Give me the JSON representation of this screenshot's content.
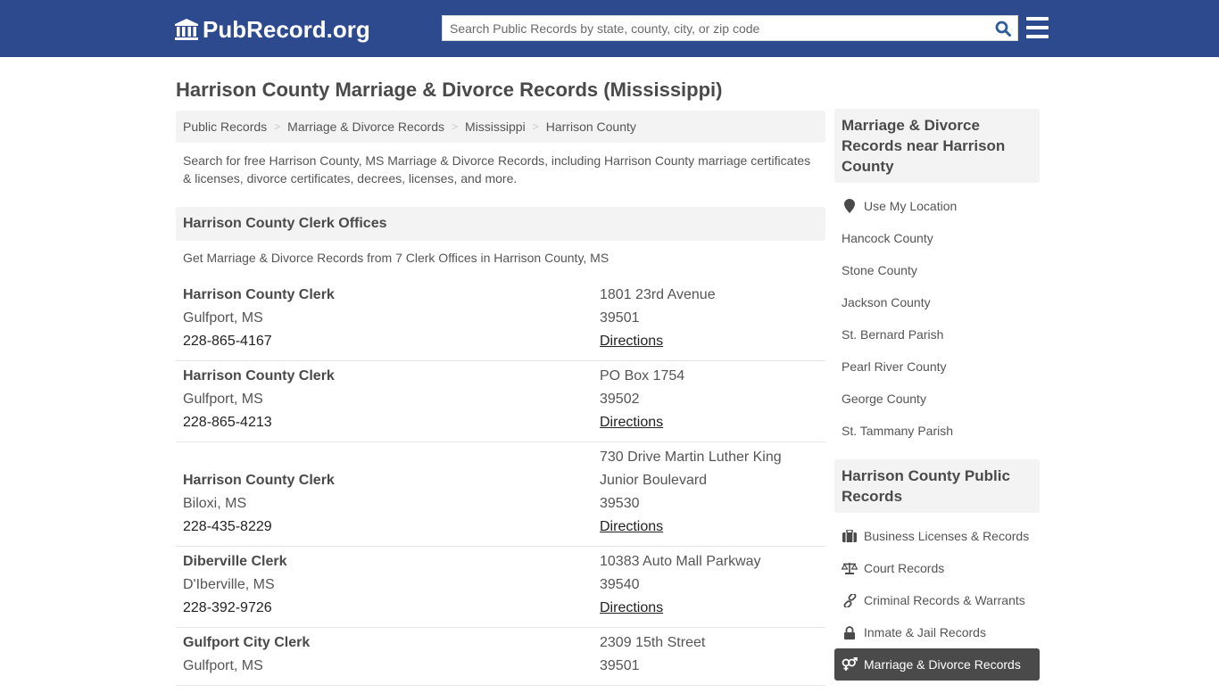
{
  "header": {
    "logo_text": "PubRecord.org",
    "search_placeholder": "Search Public Records by state, county, city, or zip code",
    "search_value": "",
    "icons": {
      "logo": "courthouse-icon",
      "search": "search-icon",
      "menu": "hamburger-menu-icon"
    },
    "brand_color": "#2e4a8f"
  },
  "page": {
    "title": "Harrison County Marriage & Divorce Records (Mississippi)"
  },
  "breadcrumb": [
    {
      "label": "Public Records"
    },
    {
      "label": "Marriage & Divorce Records"
    },
    {
      "label": "Mississippi"
    },
    {
      "label": "Harrison County"
    }
  ],
  "breadcrumb_separator": ">",
  "intro": "Search for free Harrison County, MS Marriage & Divorce Records, including Harrison County marriage certificates & licenses, divorce certificates, decrees, licenses, and more.",
  "clerk_section": {
    "heading": "Harrison County Clerk Offices",
    "subheading": "Get Marriage & Divorce Records from 7 Clerk Offices in Harrison County, MS",
    "offices": [
      {
        "name": "Harrison County Clerk",
        "city": "Gulfport, MS",
        "phone": "228-865-4167",
        "address": [
          "1801 23rd Avenue"
        ],
        "zip": "39501",
        "directions": "Directions"
      },
      {
        "name": "Harrison County Clerk",
        "city": "Gulfport, MS",
        "phone": "228-865-4213",
        "address": [
          "PO Box 1754"
        ],
        "zip": "39502",
        "directions": "Directions"
      },
      {
        "name": "Harrison County Clerk",
        "city": "Biloxi, MS",
        "phone": "228-435-8229",
        "address": [
          "730 Drive Martin Luther King",
          "Junior Boulevard"
        ],
        "zip": "39530",
        "directions": "Directions"
      },
      {
        "name": "Diberville Clerk",
        "city": "D'Iberville, MS",
        "phone": "228-392-9726",
        "address": [
          "10383 Auto Mall Parkway"
        ],
        "zip": "39540",
        "directions": "Directions"
      },
      {
        "name": "Gulfport City Clerk",
        "city": "Gulfport, MS",
        "phone": "",
        "address": [
          "2309 15th Street"
        ],
        "zip": "39501",
        "directions": ""
      }
    ]
  },
  "sidebar": {
    "nearby": {
      "heading": "Marriage & Divorce Records near Harrison County",
      "use_location": {
        "label": "Use My Location",
        "icon": "map-marker-icon"
      },
      "items": [
        {
          "label": "Hancock County"
        },
        {
          "label": "Stone County"
        },
        {
          "label": "Jackson County"
        },
        {
          "label": "St. Bernard Parish"
        },
        {
          "label": "Pearl River County"
        },
        {
          "label": "George County"
        },
        {
          "label": "St. Tammany Parish"
        }
      ]
    },
    "public_records": {
      "heading": "Harrison County Public Records",
      "items": [
        {
          "label": "Business Licenses & Records",
          "icon": "briefcase-icon",
          "active": false
        },
        {
          "label": "Court Records",
          "icon": "balance-scale-icon",
          "active": false
        },
        {
          "label": "Criminal Records & Warrants",
          "icon": "link-icon",
          "active": false
        },
        {
          "label": "Inmate & Jail Records",
          "icon": "lock-icon",
          "active": false
        },
        {
          "label": "Marriage & Divorce Records",
          "icon": "venus-mars-icon",
          "active": true
        }
      ]
    }
  }
}
